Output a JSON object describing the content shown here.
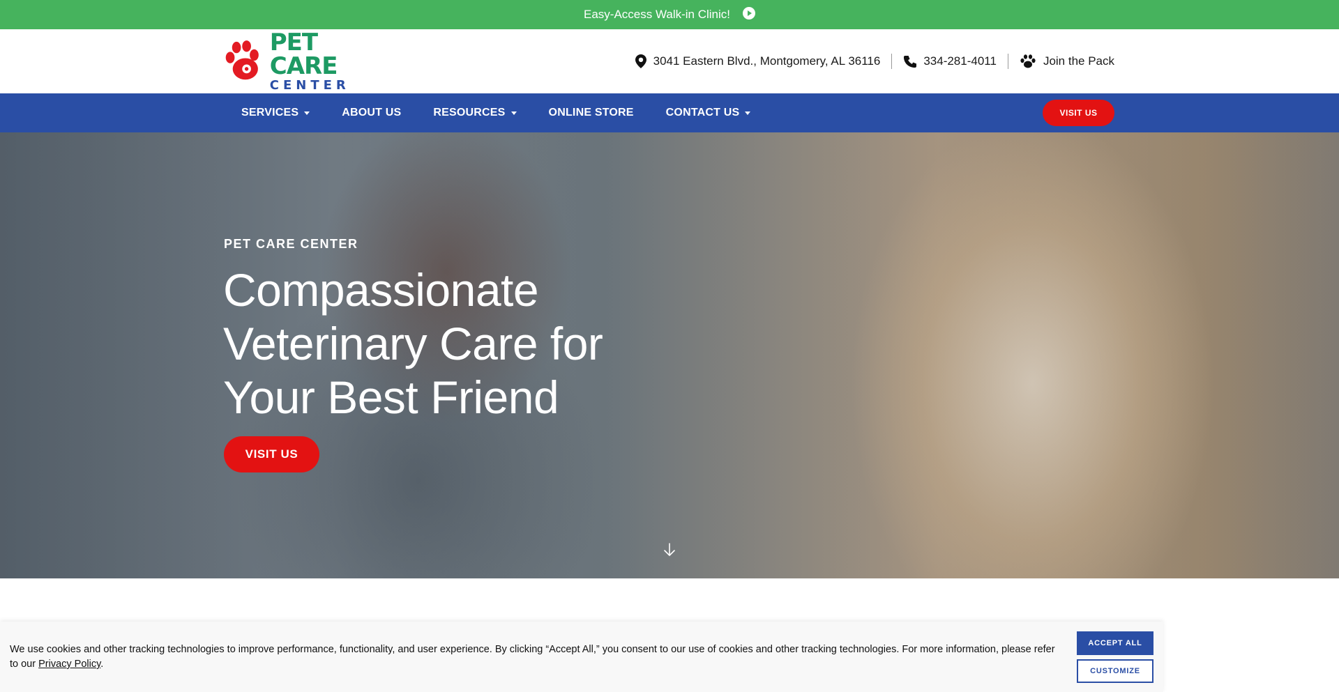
{
  "announcement": {
    "text": "Easy-Access Walk-in Clinic!",
    "icon": "arrow-right-circle-icon"
  },
  "logo": {
    "line1": "PET CARE",
    "line2": "CENTER",
    "colors": {
      "paw": "#e31b23",
      "line1": "#1d9a63",
      "line2": "#2a4ea5"
    }
  },
  "contact": {
    "address": "3041 Eastern Blvd., Montgomery, AL 36116",
    "phone": "334-281-4011",
    "join": "Join the Pack"
  },
  "nav": {
    "items": [
      {
        "label": "SERVICES",
        "dropdown": true
      },
      {
        "label": "ABOUT US",
        "dropdown": false
      },
      {
        "label": "RESOURCES",
        "dropdown": true
      },
      {
        "label": "ONLINE STORE",
        "dropdown": false
      },
      {
        "label": "CONTACT US",
        "dropdown": true
      }
    ],
    "visit_label": "VISIT US"
  },
  "hero": {
    "eyebrow": "PET CARE CENTER",
    "title_lines": [
      "Compassionate",
      "Veterinary Care for",
      "Your Best Friend"
    ],
    "cta_label": "VISIT US"
  },
  "cookie": {
    "text_before": "We use cookies and other tracking technologies to improve performance, functionality, and user experience. By clicking “Accept All,” you consent to our use of cookies and other tracking technologies. For more information, please refer to our ",
    "link_label": "Privacy Policy",
    "text_after": ".",
    "accept_label": "ACCEPT ALL",
    "customize_label": "CUSTOMIZE"
  },
  "colors": {
    "topbar": "#46b35d",
    "navbar": "#2a4ea5",
    "cta": "#e31212"
  }
}
